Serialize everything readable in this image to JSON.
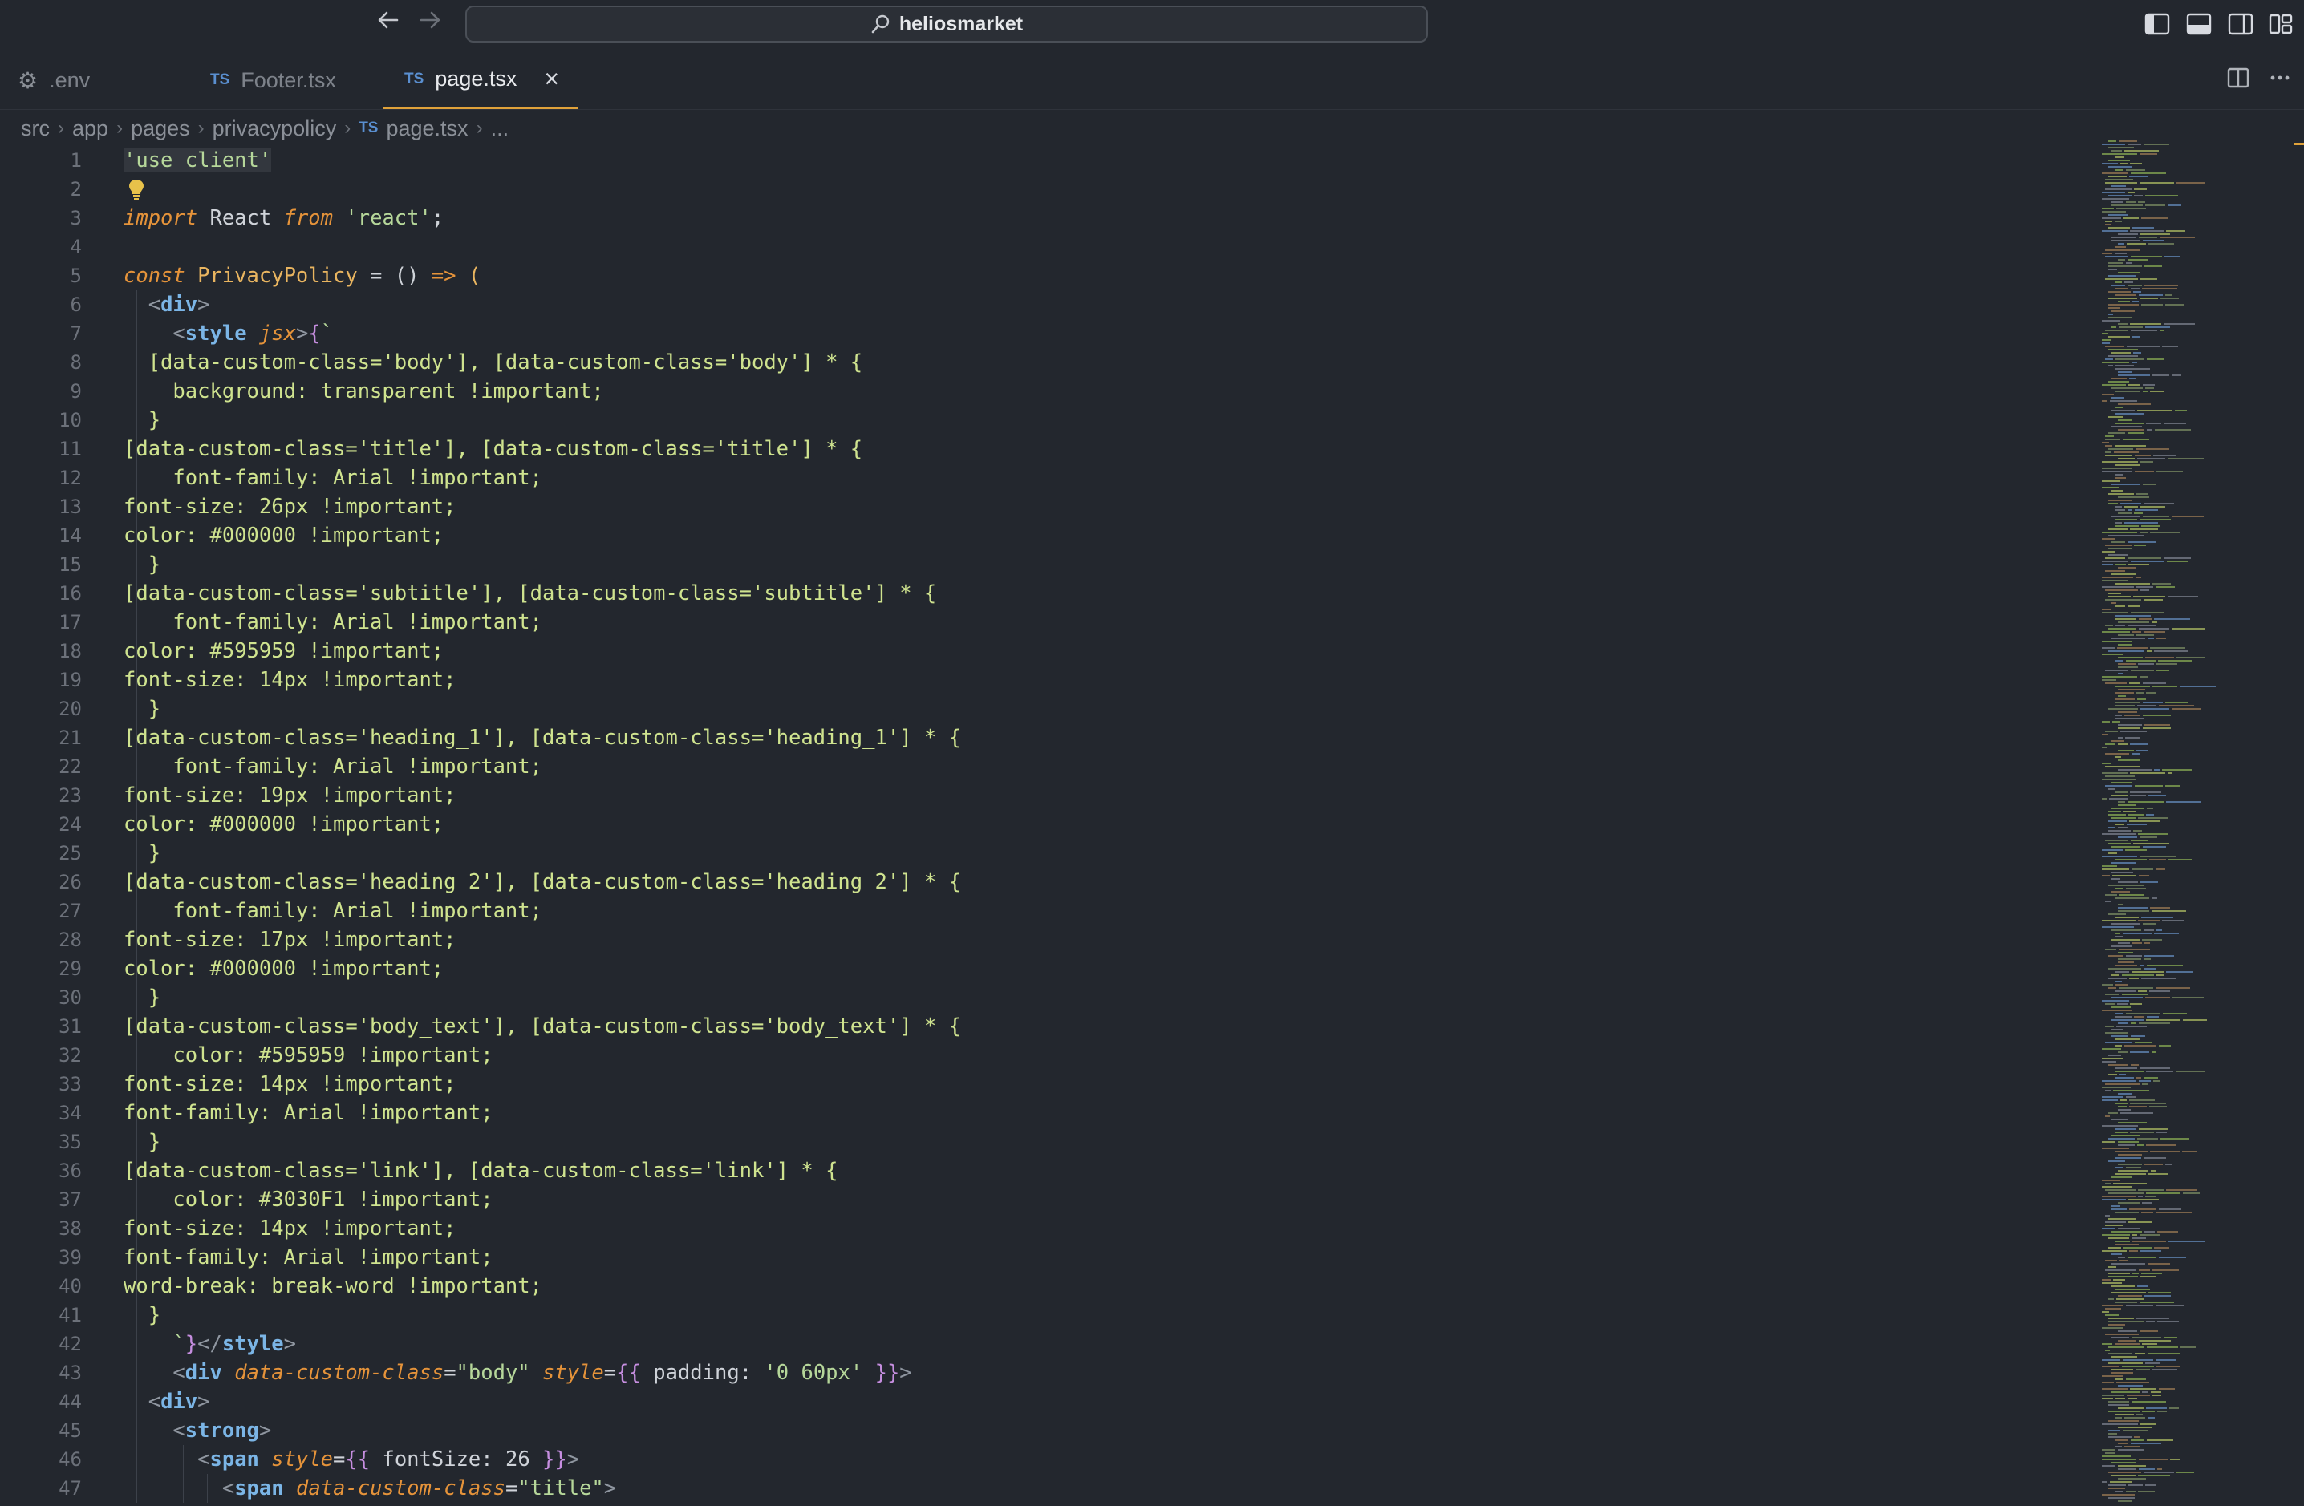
{
  "titlebar": {
    "back_icon": "arrow-left-icon",
    "forward_icon": "arrow-right-icon",
    "search_text": "heliosmarket",
    "layout_icons": [
      "sidebar-left-icon",
      "panel-bottom-icon",
      "sidebar-right-icon",
      "layout-custom-icon"
    ]
  },
  "tabs": [
    {
      "label": ".env",
      "icon": "gear-icon",
      "active": false
    },
    {
      "label": "Footer.tsx",
      "icon": "TS",
      "active": false
    },
    {
      "label": "page.tsx",
      "icon": "TS",
      "active": true
    }
  ],
  "tab_close": "×",
  "tab_actions": {
    "split_icon": "split-editor-icon",
    "more_icon": "more-icon"
  },
  "breadcrumb": {
    "parts": [
      "src",
      "app",
      "pages",
      "privacypolicy"
    ],
    "file_badge": "TS",
    "file": "page.tsx",
    "tail": "..."
  },
  "accent_color": "#e0a23a",
  "editor": {
    "line_numbers": [
      "1",
      "2",
      "3",
      "4",
      "5",
      "6",
      "7",
      "8",
      "9",
      "10",
      "11",
      "12",
      "13",
      "14",
      "15",
      "16",
      "17",
      "18",
      "19",
      "20",
      "21",
      "22",
      "23",
      "24",
      "25",
      "26",
      "27",
      "28",
      "29",
      "30",
      "31",
      "32",
      "33",
      "34",
      "35",
      "36",
      "37",
      "38",
      "39",
      "40",
      "41",
      "42",
      "43",
      "44",
      "45",
      "46",
      "47"
    ],
    "lines": [
      [
        [
          "str",
          "'use client'"
        ]
      ],
      [],
      [
        [
          "kw",
          "import"
        ],
        [
          "plain",
          " React "
        ],
        [
          "kw",
          "from"
        ],
        [
          "str",
          " 'react'"
        ],
        [
          "plain",
          ";"
        ]
      ],
      [],
      [
        [
          "kw",
          "const"
        ],
        [
          "fn",
          " PrivacyPolicy"
        ],
        [
          "plain",
          " = () "
        ],
        [
          "kw",
          "=>"
        ],
        [
          "fn",
          " ("
        ]
      ],
      [
        [
          "plain",
          "  "
        ],
        [
          "punc",
          "<"
        ],
        [
          "tag",
          "div"
        ],
        [
          "punc",
          ">"
        ]
      ],
      [
        [
          "plain",
          "    "
        ],
        [
          "punc",
          "<"
        ],
        [
          "tag",
          "style"
        ],
        [
          "attr",
          " jsx"
        ],
        [
          "punc",
          ">"
        ],
        [
          "brace",
          "{"
        ],
        [
          "str",
          "`"
        ]
      ],
      [
        [
          "css",
          "  [data-custom-class='body'], [data-custom-class='body'] * {"
        ]
      ],
      [
        [
          "css",
          "    background: transparent !important;"
        ]
      ],
      [
        [
          "css",
          "  }"
        ]
      ],
      [
        [
          "css",
          "[data-custom-class='title'], [data-custom-class='title'] * {"
        ]
      ],
      [
        [
          "css",
          "    font-family: Arial !important;"
        ]
      ],
      [
        [
          "css",
          "font-size: 26px !important;"
        ]
      ],
      [
        [
          "css",
          "color: #000000 !important;"
        ]
      ],
      [
        [
          "css",
          "  }"
        ]
      ],
      [
        [
          "css",
          "[data-custom-class='subtitle'], [data-custom-class='subtitle'] * {"
        ]
      ],
      [
        [
          "css",
          "    font-family: Arial !important;"
        ]
      ],
      [
        [
          "css",
          "color: #595959 !important;"
        ]
      ],
      [
        [
          "css",
          "font-size: 14px !important;"
        ]
      ],
      [
        [
          "css",
          "  }"
        ]
      ],
      [
        [
          "css",
          "[data-custom-class='heading_1'], [data-custom-class='heading_1'] * {"
        ]
      ],
      [
        [
          "css",
          "    font-family: Arial !important;"
        ]
      ],
      [
        [
          "css",
          "font-size: 19px !important;"
        ]
      ],
      [
        [
          "css",
          "color: #000000 !important;"
        ]
      ],
      [
        [
          "css",
          "  }"
        ]
      ],
      [
        [
          "css",
          "[data-custom-class='heading_2'], [data-custom-class='heading_2'] * {"
        ]
      ],
      [
        [
          "css",
          "    font-family: Arial !important;"
        ]
      ],
      [
        [
          "css",
          "font-size: 17px !important;"
        ]
      ],
      [
        [
          "css",
          "color: #000000 !important;"
        ]
      ],
      [
        [
          "css",
          "  }"
        ]
      ],
      [
        [
          "css",
          "[data-custom-class='body_text'], [data-custom-class='body_text'] * {"
        ]
      ],
      [
        [
          "css",
          "    color: #595959 !important;"
        ]
      ],
      [
        [
          "css",
          "font-size: 14px !important;"
        ]
      ],
      [
        [
          "css",
          "font-family: Arial !important;"
        ]
      ],
      [
        [
          "css",
          "  }"
        ]
      ],
      [
        [
          "css",
          "[data-custom-class='link'], [data-custom-class='link'] * {"
        ]
      ],
      [
        [
          "css",
          "    color: #3030F1 !important;"
        ]
      ],
      [
        [
          "css",
          "font-size: 14px !important;"
        ]
      ],
      [
        [
          "css",
          "font-family: Arial !important;"
        ]
      ],
      [
        [
          "css",
          "word-break: break-word !important;"
        ]
      ],
      [
        [
          "css",
          "  }"
        ]
      ],
      [
        [
          "plain",
          "    "
        ],
        [
          "str",
          "`"
        ],
        [
          "brace",
          "}"
        ],
        [
          "punc",
          "</"
        ],
        [
          "tag",
          "style"
        ],
        [
          "punc",
          ">"
        ]
      ],
      [
        [
          "plain",
          "    "
        ],
        [
          "punc",
          "<"
        ],
        [
          "tag",
          "div"
        ],
        [
          "attr",
          " data-custom-class"
        ],
        [
          "plain",
          "="
        ],
        [
          "str",
          "\"body\""
        ],
        [
          "attr",
          " style"
        ],
        [
          "plain",
          "="
        ],
        [
          "brace",
          "{{"
        ],
        [
          "plain",
          " padding: "
        ],
        [
          "str",
          "'0 60px'"
        ],
        [
          "brace",
          " }}"
        ],
        [
          "punc",
          ">"
        ]
      ],
      [
        [
          "plain",
          "  "
        ],
        [
          "punc",
          "<"
        ],
        [
          "tag",
          "div"
        ],
        [
          "punc",
          ">"
        ]
      ],
      [
        [
          "plain",
          "    "
        ],
        [
          "punc",
          "<"
        ],
        [
          "tag",
          "strong"
        ],
        [
          "punc",
          ">"
        ]
      ],
      [
        [
          "plain",
          "      "
        ],
        [
          "punc",
          "<"
        ],
        [
          "tag",
          "span"
        ],
        [
          "attr",
          " style"
        ],
        [
          "plain",
          "="
        ],
        [
          "brace",
          "{{"
        ],
        [
          "plain",
          " fontSize: 26 "
        ],
        [
          "brace",
          "}}"
        ],
        [
          "punc",
          ">"
        ]
      ],
      [
        [
          "plain",
          "        "
        ],
        [
          "punc",
          "<"
        ],
        [
          "tag",
          "span"
        ],
        [
          "attr",
          " data-custom-class"
        ],
        [
          "plain",
          "="
        ],
        [
          "str",
          "\"title\""
        ],
        [
          "punc",
          ">"
        ]
      ]
    ]
  }
}
